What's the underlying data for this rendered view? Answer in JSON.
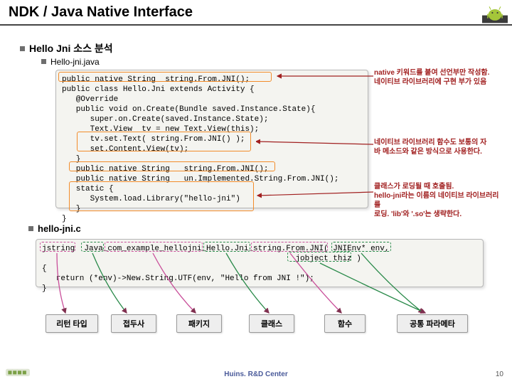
{
  "title": "NDK / Java Native Interface",
  "section1": "Hello Jni 소스 분석",
  "section2": "Hello-jni.java",
  "java_code": "public native String  string.From.JNI();\npublic class Hello.Jni extends Activity {\n   @Override\n   public void on.Create(Bundle saved.Instance.State){\n      super.on.Create(saved.Instance.State);\n      Text.View  tv = new Text.View(this);\n      tv.set.Text( string.From.JNI() );\n      set.Content.View(tv);\n   }\n   public native String   string.From.JNI();\n   public native String   un.Implemented.String.From.JNI();\n   static {\n      System.load.Library(\"hello-jni\")\n   }\n}",
  "note1_l1": "native 키워드를 붙여 선언부만 작성함.",
  "note1_l2": "네이티브 라이브러리에 구현 부가 있음",
  "note2_l1": "네이티브 라이브러리 함수도 보통의 자",
  "note2_l2": "바 메소드와 같은 방식으로 사용한다.",
  "note3_l1": "클래스가 로딩될 때 호출됨.",
  "note3_l2": "hello-jni라는 이름의 네이티브 라이브러리를",
  "note3_l3": "로딩. 'lib'와 '.so'는 생략한다.",
  "section3": "hello-jni.c",
  "c_code": "jstring  Java_com_example_hellojni_Hello.Jni_string.From.JNI( JNIEnv* env,\n                                                      jobject thiz )\n{\n   return (*env)->New.String.UTF(env, \"Hello from JNI !\");\n}",
  "labels": {
    "l1": "리턴 타입",
    "l2": "접두사",
    "l3": "패키지",
    "l4": "클래스",
    "l5": "함수",
    "l6": "공통 파라메타"
  },
  "footer": "Huins. R&D Center",
  "page": "10"
}
